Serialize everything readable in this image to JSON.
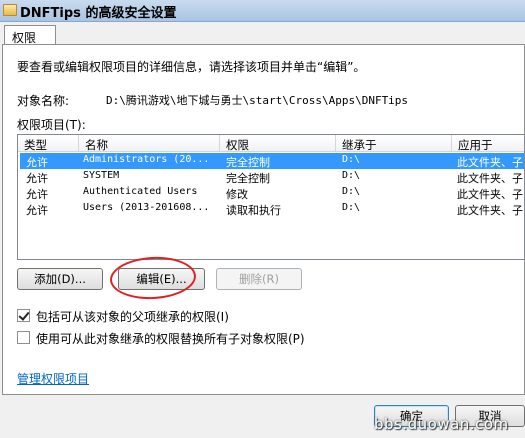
{
  "window": {
    "title": "DNFTips 的高级安全设置"
  },
  "tabs": [
    {
      "label": "权限"
    }
  ],
  "panel": {
    "info": "要查看或编辑权限项目的详细信息，请选择该项目并单击“编辑”。",
    "object_name_label": "对象名称:",
    "object_name_value": "D:\\腾讯游戏\\地下城与勇士\\start\\Cross\\Apps\\DNFTips",
    "entries_label": "权限项目(T):"
  },
  "columns": [
    "类型",
    "名称",
    "权限",
    "继承于",
    "应用于"
  ],
  "rows": [
    {
      "type": "允许",
      "name": "Administrators (20...",
      "permission": "完全控制",
      "inherited": "D:\\",
      "applies": "此文件夹、子"
    },
    {
      "type": "允许",
      "name": "SYSTEM",
      "permission": "完全控制",
      "inherited": "D:\\",
      "applies": "此文件夹、子"
    },
    {
      "type": "允许",
      "name": "Authenticated Users",
      "permission": "修改",
      "inherited": "D:\\",
      "applies": "此文件夹、子"
    },
    {
      "type": "允许",
      "name": "Users (2013-201608...",
      "permission": "读取和执行",
      "inherited": "D:\\",
      "applies": "此文件夹、子"
    }
  ],
  "buttons": {
    "add": "添加(D)...",
    "edit": "编辑(E)...",
    "remove": "删除(R)",
    "ok": "确定",
    "cancel": "取消"
  },
  "checkboxes": {
    "include_inheritable": {
      "label": "包括可从该对象的父项继承的权限(I)",
      "checked": true
    },
    "replace_child": {
      "label": "使用可从此对象继承的权限替换所有子对象权限(P)",
      "checked": false
    }
  },
  "link": "管理权限项目",
  "watermark": "bbs.duowan.com",
  "colors": {
    "selection": "#3399ff",
    "link": "#0066cc",
    "annotation": "#e02020"
  }
}
